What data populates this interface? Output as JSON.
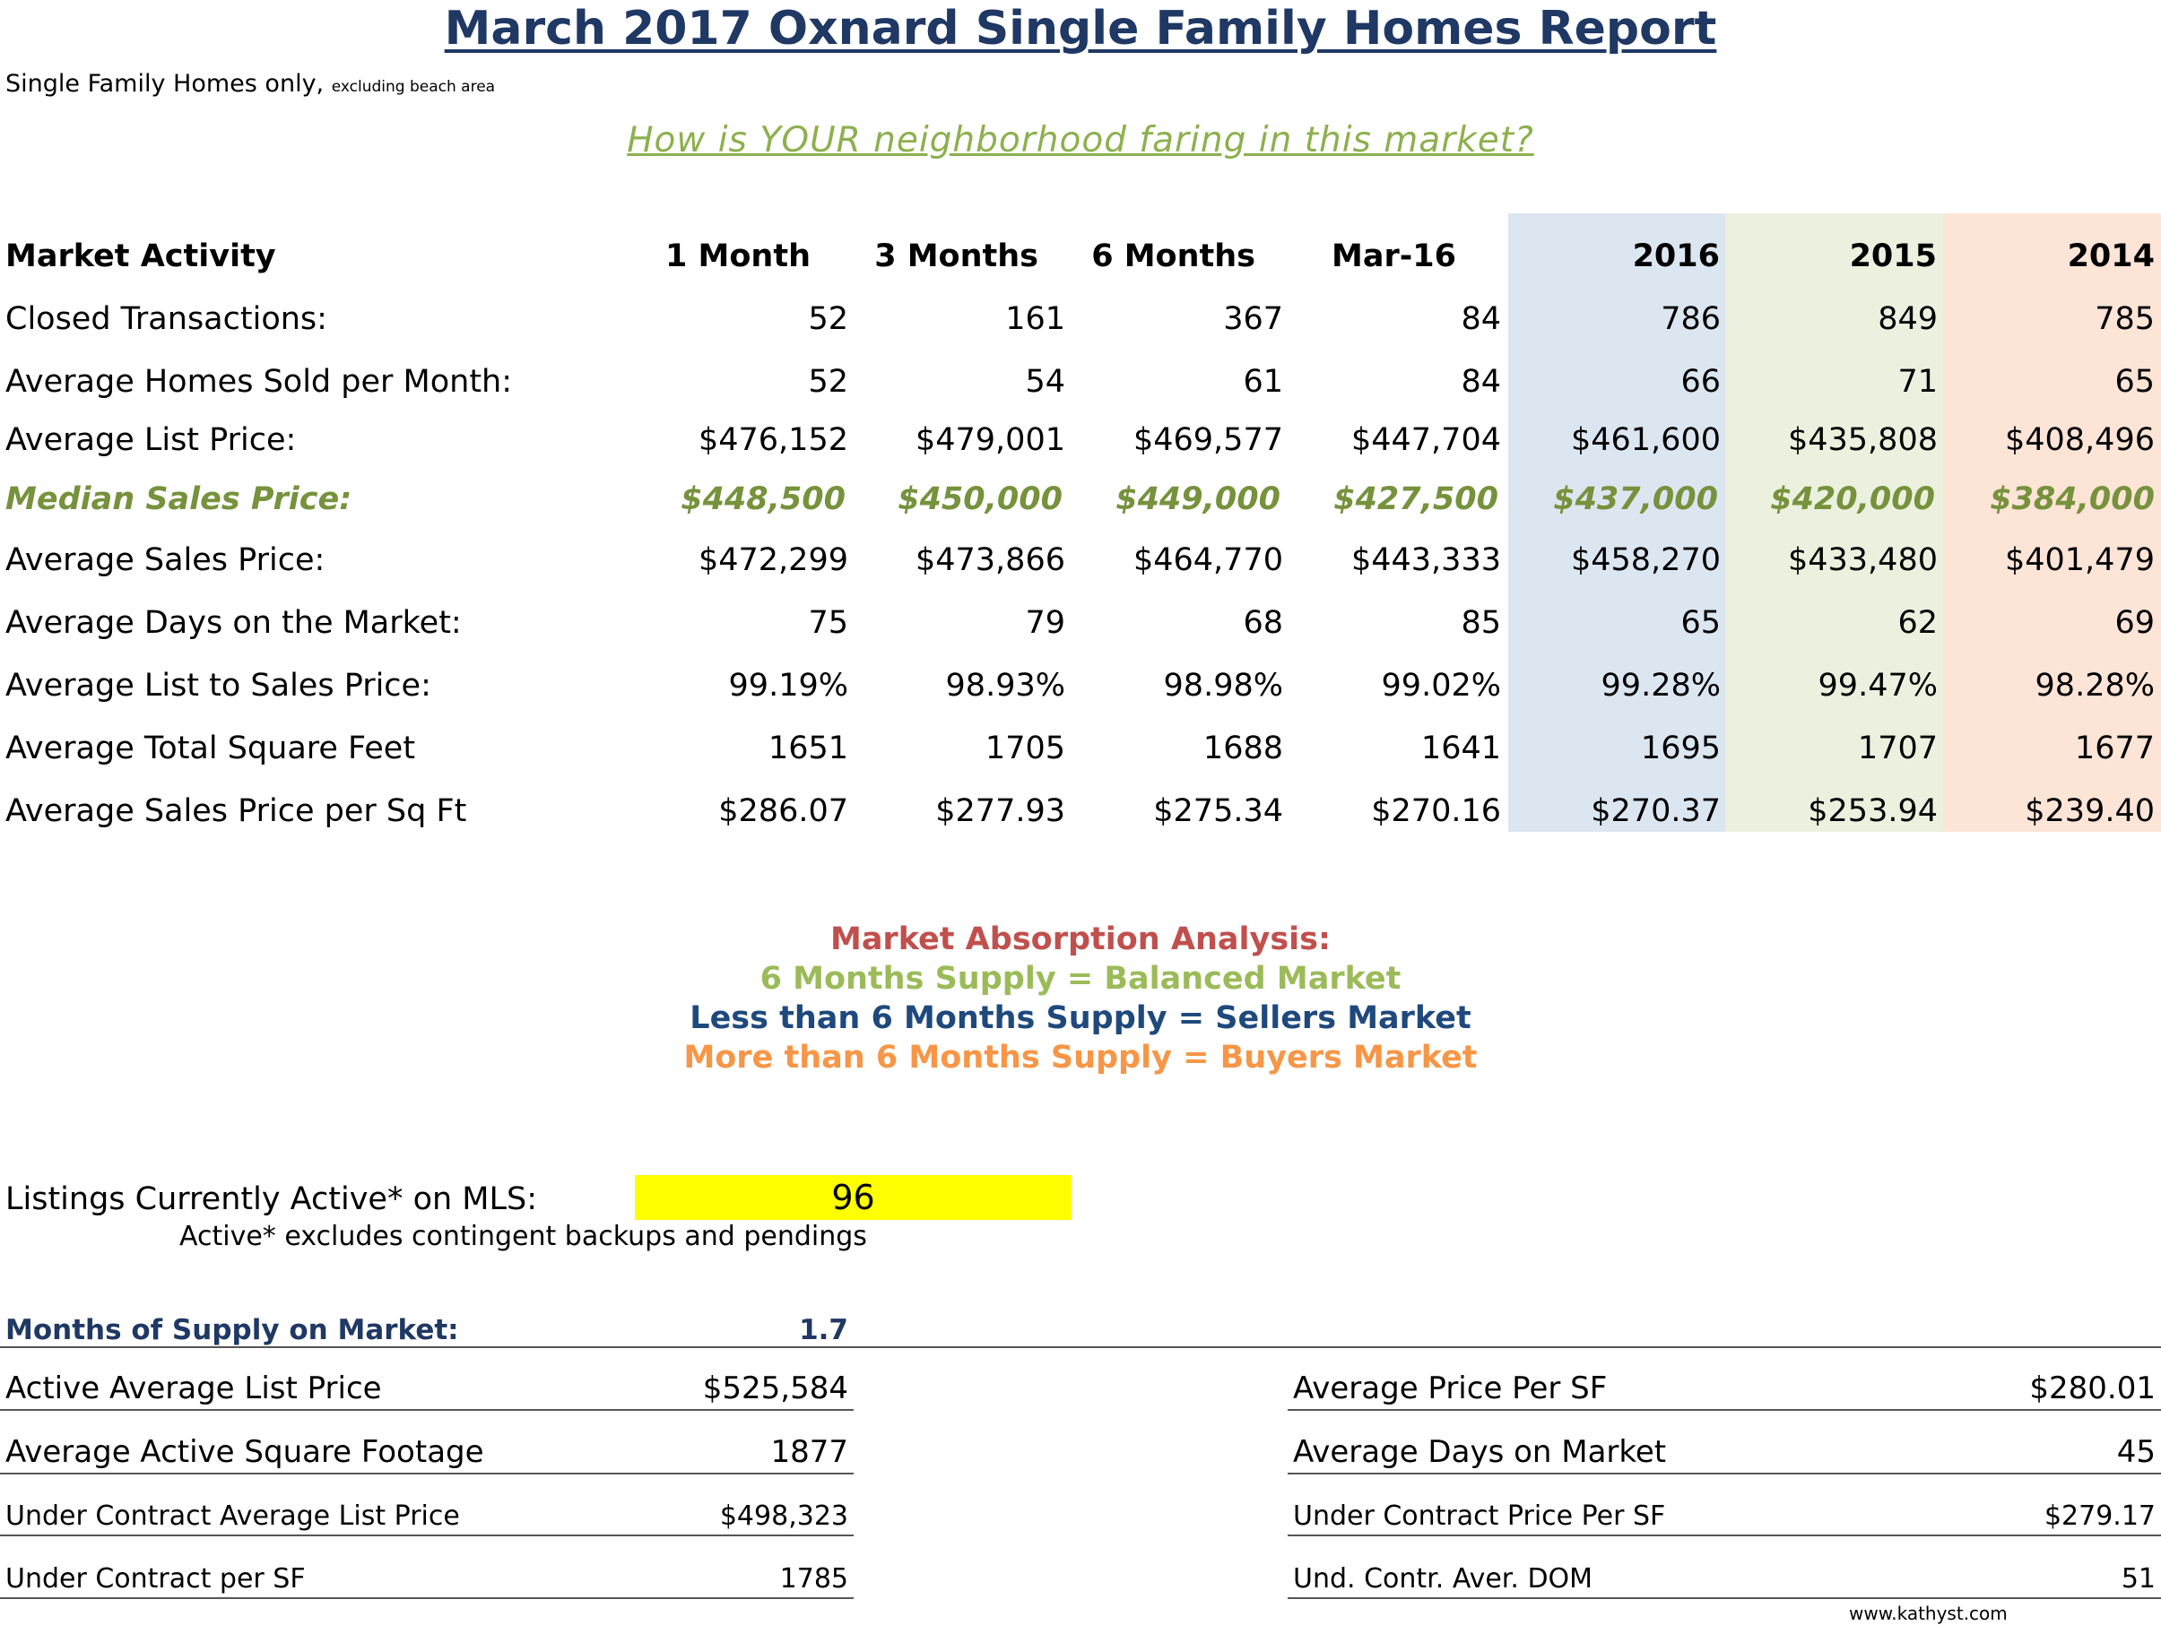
{
  "header": {
    "title": "March 2017 Oxnard Single Family Homes Report",
    "subtitle_main": "Single Family Homes only,",
    "subtitle_small": "excluding beach area",
    "question": "How is YOUR neighborhood faring in this market?"
  },
  "colors": {
    "title": "#1F3864",
    "question": "#8DB04E",
    "median": "#76923C",
    "shade_2016": "#DCE6F1",
    "shade_2015": "#EBF1DE",
    "shade_2014": "#FCE4D6",
    "absorption_title": "#C0504D",
    "balanced": "#9BBB59",
    "sellers": "#1F497D",
    "buyers": "#F79646",
    "highlight": "#FFFF00"
  },
  "table": {
    "label_header": "Market Activity",
    "columns": [
      "1 Month",
      "3 Months",
      "6 Months",
      "Mar-16",
      "2016",
      "2015",
      "2014"
    ],
    "rows": [
      {
        "label": "Closed Transactions:",
        "values": [
          "52",
          "161",
          "367",
          "84",
          "786",
          "849",
          "785"
        ]
      },
      {
        "label": "Average Homes Sold per Month:",
        "values": [
          "52",
          "54",
          "61",
          "84",
          "66",
          "71",
          "65"
        ]
      },
      {
        "label": "Average List Price:",
        "values": [
          "$476,152",
          "$479,001",
          "$469,577",
          "$447,704",
          "$461,600",
          "$435,808",
          "$408,496"
        ]
      },
      {
        "label": "Median Sales Price:",
        "values": [
          "$448,500",
          "$450,000",
          "$449,000",
          "$427,500",
          "$437,000",
          "$420,000",
          "$384,000"
        ]
      },
      {
        "label": "Average Sales Price:",
        "values": [
          "$472,299",
          "$473,866",
          "$464,770",
          "$443,333",
          "$458,270",
          "$433,480",
          "$401,479"
        ]
      },
      {
        "label": "Average Days on the Market:",
        "values": [
          "75",
          "79",
          "68",
          "85",
          "65",
          "62",
          "69"
        ]
      },
      {
        "label": "Average List to Sales Price:",
        "values": [
          "99.19%",
          "98.93%",
          "98.98%",
          "99.02%",
          "99.28%",
          "99.47%",
          "98.28%"
        ]
      },
      {
        "label": "Average Total Square Feet",
        "values": [
          "1651",
          "1705",
          "1688",
          "1641",
          "1695",
          "1707",
          "1677"
        ]
      },
      {
        "label": "Average Sales Price per Sq Ft",
        "values": [
          "$286.07",
          "$277.93",
          "$275.34",
          "$270.16",
          "$270.37",
          "$253.94",
          "$239.40"
        ]
      }
    ]
  },
  "absorption": {
    "title": "Market Absorption Analysis:",
    "balanced": "6 Months Supply = Balanced Market",
    "sellers": "Less than 6 Months Supply = Sellers Market",
    "buyers": "More than 6 Months Supply = Buyers Market"
  },
  "active": {
    "label": "Listings Currently Active* on MLS:",
    "value": "96",
    "note": "Active* excludes contingent backups and pendings"
  },
  "supply": {
    "label": "Months of Supply on Market:",
    "value": "1.7"
  },
  "stats_left": [
    {
      "label": "Active Average List Price",
      "value": "$525,584"
    },
    {
      "label": "Average Active Square Footage",
      "value": "1877"
    },
    {
      "label": "Under Contract Average List Price",
      "value": "$498,323"
    },
    {
      "label": "Under Contract per SF",
      "value": "1785"
    }
  ],
  "stats_right": [
    {
      "label": "Average Price Per SF",
      "value": "$280.01"
    },
    {
      "label": "Average Days on Market",
      "value": "45"
    },
    {
      "label": "Under Contract Price Per SF",
      "value": "$279.17"
    },
    {
      "label": "Und. Contr. Aver. DOM",
      "value": "51"
    }
  ],
  "footer": {
    "url": "www.kathyst.com"
  }
}
